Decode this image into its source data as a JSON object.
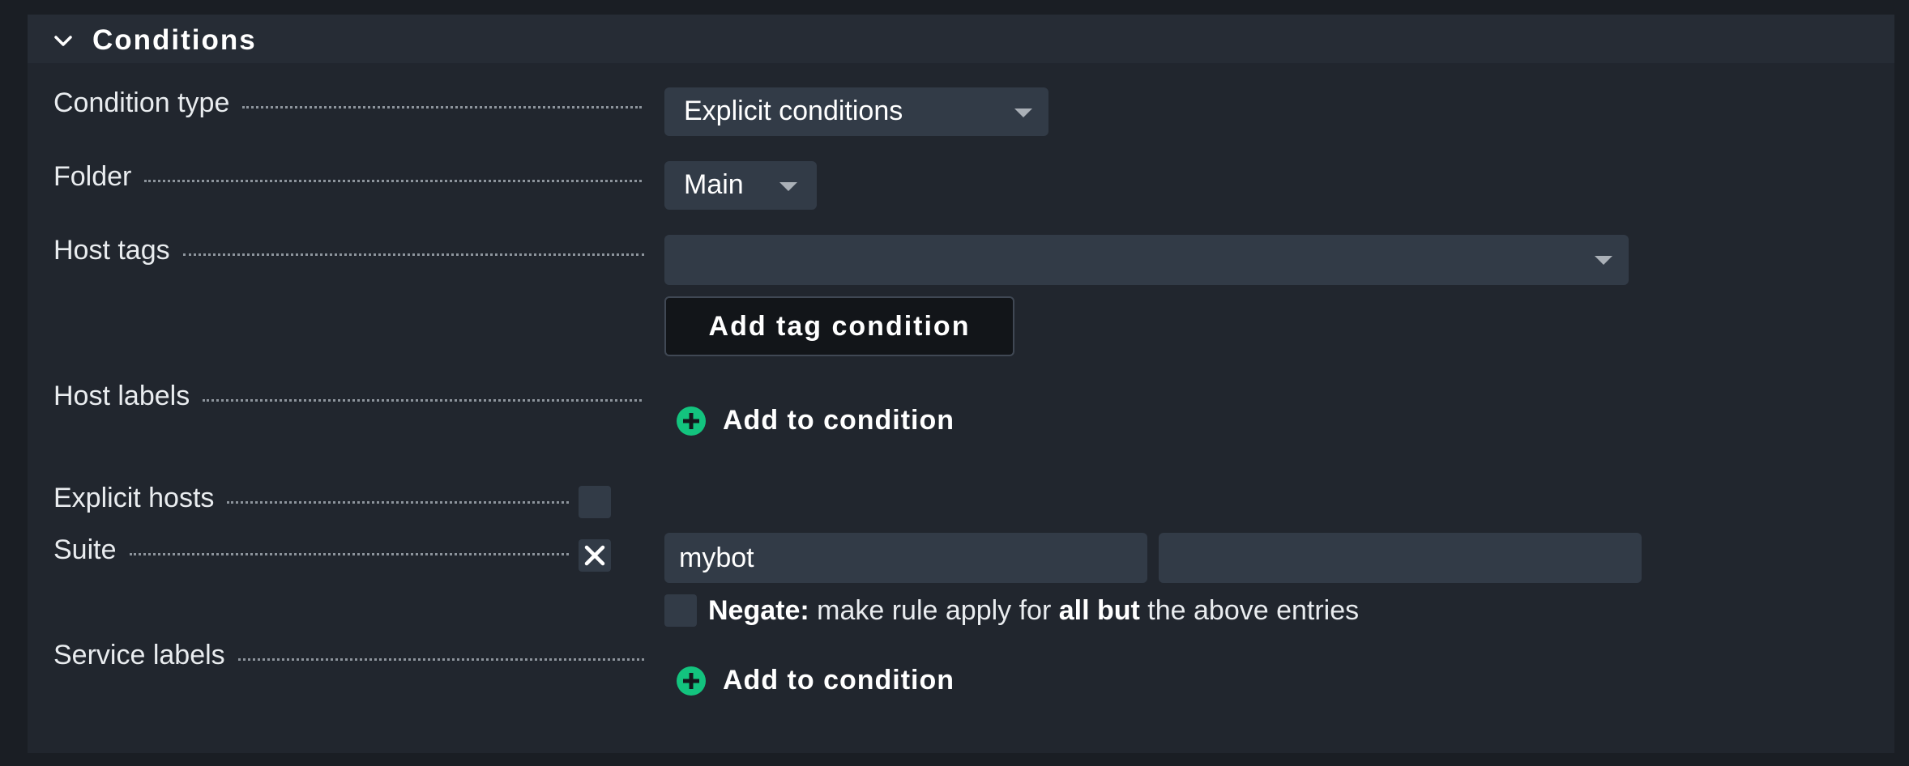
{
  "section": {
    "title": "Conditions"
  },
  "rows": {
    "condition_type": {
      "label": "Condition type",
      "value": "Explicit conditions"
    },
    "folder": {
      "label": "Folder",
      "value": "Main"
    },
    "host_tags": {
      "label": "Host tags",
      "value": "",
      "button": "Add tag condition"
    },
    "host_labels": {
      "label": "Host labels",
      "action": "Add to condition"
    },
    "explicit_hosts": {
      "label": "Explicit hosts",
      "checked": false
    },
    "suite": {
      "label": "Suite",
      "checked": true,
      "input_1": "mybot",
      "input_2": "",
      "negate_strong": "Negate:",
      "negate_text_1": " make rule apply for ",
      "negate_strong_2": "all but",
      "negate_text_2": " the above entries"
    },
    "service_labels": {
      "label": "Service labels",
      "action": "Add to condition"
    }
  },
  "icons": {
    "collapse": "chevron-down-icon",
    "dropdown": "dropdown-arrow-icon",
    "add": "plus-circle-icon",
    "remove": "close-icon"
  },
  "colors": {
    "background": "#1a1e24",
    "panel": "#21262e",
    "panel_header": "#262c35",
    "input": "#323b47",
    "accent_green": "#13c37e",
    "text": "#e9ecef"
  }
}
